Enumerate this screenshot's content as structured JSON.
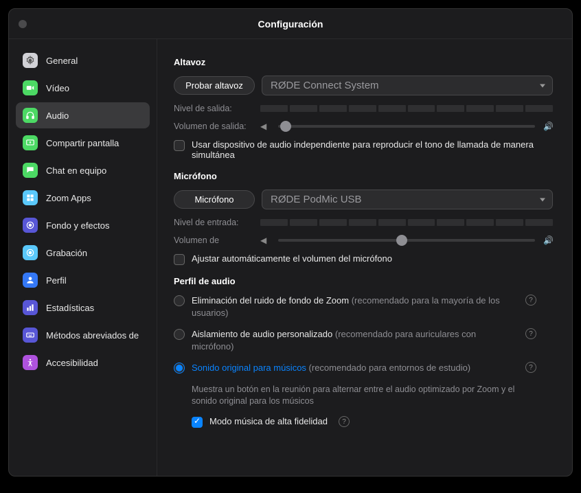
{
  "window": {
    "title": "Configuración"
  },
  "sidebar": {
    "items": [
      {
        "label": "General",
        "icon_bg": "#d1d1d6"
      },
      {
        "label": "Vídeo",
        "icon_bg": "#4cd964"
      },
      {
        "label": "Audio",
        "icon_bg": "#4cd964"
      },
      {
        "label": "Compartir pantalla",
        "icon_bg": "#4cd964"
      },
      {
        "label": "Chat en equipo",
        "icon_bg": "#4cd964"
      },
      {
        "label": "Zoom Apps",
        "icon_bg": "#5ac8fa"
      },
      {
        "label": "Fondo y efectos",
        "icon_bg": "#5856d6"
      },
      {
        "label": "Grabación",
        "icon_bg": "#5ac8fa"
      },
      {
        "label": "Perfil",
        "icon_bg": "#3478f6"
      },
      {
        "label": "Estadísticas",
        "icon_bg": "#5856d6"
      },
      {
        "label": "Métodos abreviados de",
        "icon_bg": "#5856d6"
      },
      {
        "label": "Accesibilidad",
        "icon_bg": "#af52de"
      }
    ]
  },
  "speaker": {
    "heading": "Altavoz",
    "test_btn": "Probar altavoz",
    "device": "RØDE Connect System",
    "output_level_label": "Nivel de salida:",
    "output_volume_label": "Volumen de salida:",
    "output_volume_percent": 3,
    "ringtone_checkbox": "Usar dispositivo de audio independiente para reproducir el tono de llamada de manera simultánea"
  },
  "mic": {
    "heading": "Micrófono",
    "test_btn": "Micrófono",
    "device": "RØDE PodMic USB",
    "input_level_label": "Nivel de entrada:",
    "input_volume_label": "Volumen de",
    "input_volume_percent": 48,
    "auto_adjust": "Ajustar automáticamente el volumen del micrófono"
  },
  "profile": {
    "heading": "Perfil de audio",
    "opt1": {
      "main": "Eliminación del ruido de fondo de Zoom ",
      "hint": "(recomendado para la mayoría de los usuarios)"
    },
    "opt2": {
      "main": "Aislamiento de audio personalizado ",
      "hint": "(recomendado para auriculares con micrófono)"
    },
    "opt3": {
      "main": "Sonido original para músicos ",
      "hint": "(recomendado para entornos de estudio)"
    },
    "opt3_desc": "Muestra un botón en la reunión para alternar entre el audio optimizado por Zoom y el sonido original para los músicos",
    "hifi": "Modo música de alta fidelidad"
  }
}
